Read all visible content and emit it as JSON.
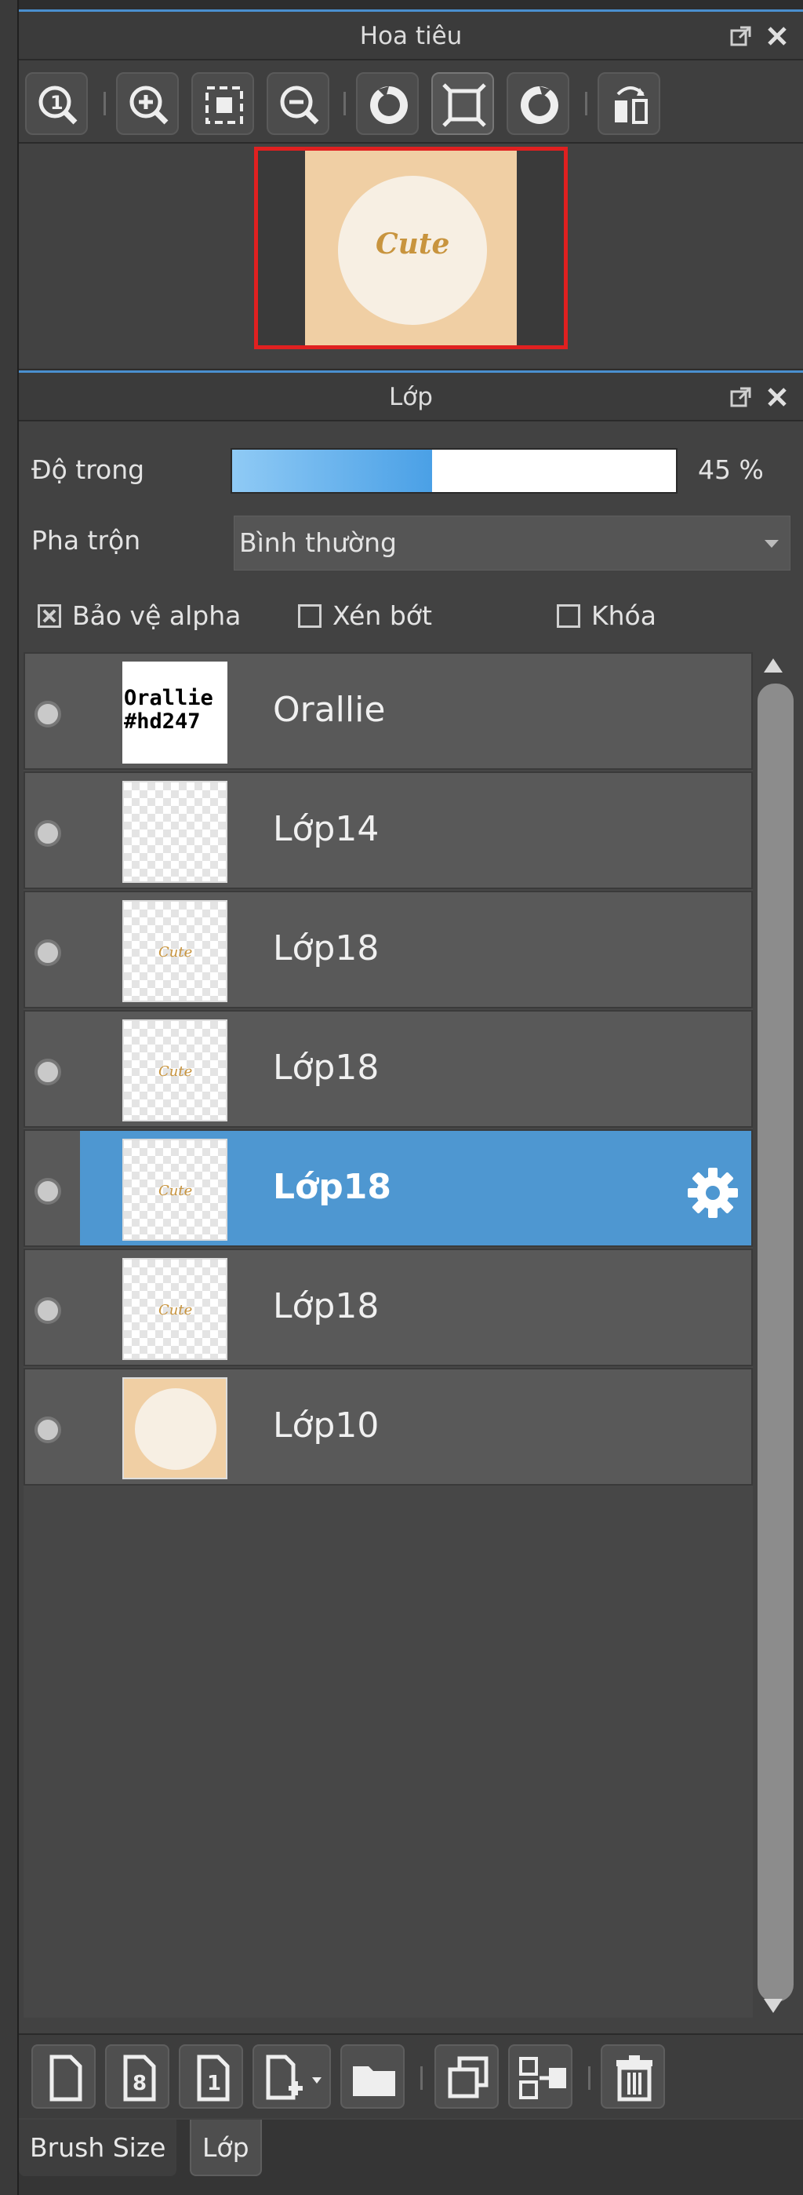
{
  "navigator": {
    "title": "Hoa tiêu",
    "icons": [
      "zoom-actual-icon",
      "zoom-in-icon",
      "fit-screen-icon",
      "zoom-out-icon",
      "rotate-left-icon",
      "fullscreen-icon",
      "rotate-right-icon",
      "flip-horizontal-icon"
    ],
    "preview_text": "Cute"
  },
  "layers_panel": {
    "title": "Lớp",
    "opacity_label": "Độ trong",
    "opacity_value": 45,
    "opacity_text": "45 %",
    "blend_label": "Pha trộn",
    "blend_value": "Bình thường",
    "checkboxes": [
      {
        "label": "Bảo vệ alpha",
        "checked": true
      },
      {
        "label": "Xén bớt",
        "checked": false
      },
      {
        "label": "Khóa",
        "checked": false
      }
    ],
    "thumb_text": "Orallie\n#hd247",
    "layers": [
      {
        "name": "Orallie",
        "selected": false
      },
      {
        "name": "Lớp14",
        "selected": false
      },
      {
        "name": "Lớp18",
        "selected": false
      },
      {
        "name": "Lớp18",
        "selected": false
      },
      {
        "name": "Lớp18",
        "selected": true
      },
      {
        "name": "Lớp18",
        "selected": false
      },
      {
        "name": "Lớp10",
        "selected": false
      }
    ],
    "thumb_mini_text": "Cute",
    "bottom_icons": [
      "new-layer-icon",
      "new-8bit-layer-icon",
      "new-1bit-layer-icon",
      "add-layer-menu-icon",
      "new-folder-icon",
      "duplicate-layer-icon",
      "merge-layer-icon",
      "delete-layer-icon"
    ]
  },
  "tabs": [
    {
      "label": "Brush Size",
      "active": false
    },
    {
      "label": "Lớp",
      "active": true
    }
  ],
  "colors": {
    "accent": "#4e97d1",
    "nav_frame": "#e02020",
    "canvas_bg": "#f0cfa4"
  }
}
